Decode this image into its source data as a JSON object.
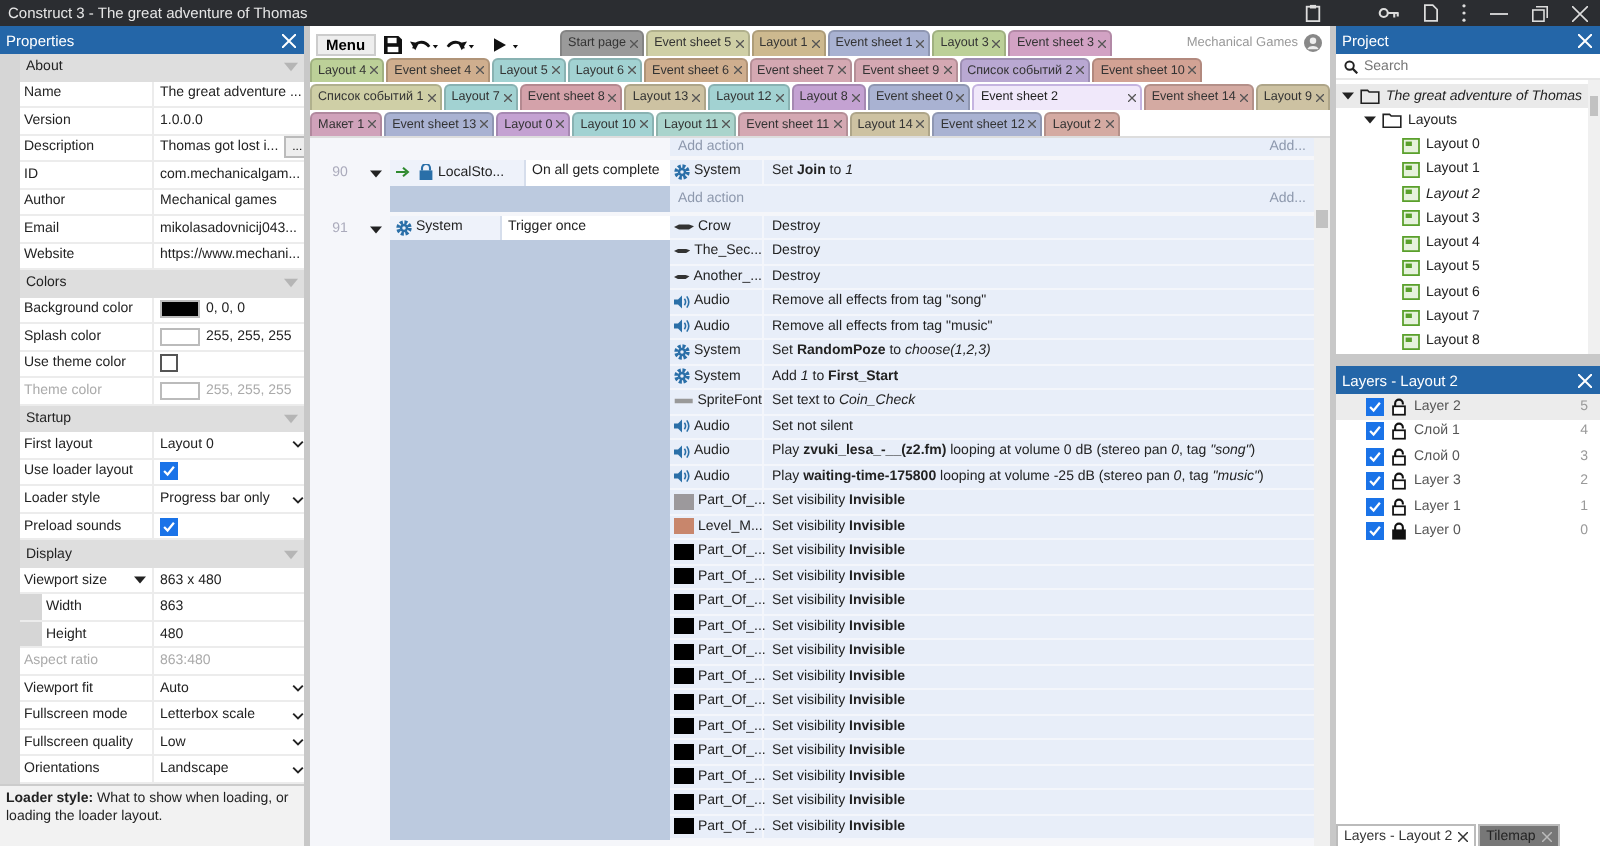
{
  "window": {
    "title": "Construct 3 - The great adventure of Thomas"
  },
  "properties": {
    "title": "Properties",
    "sections": [
      {
        "title": "About",
        "expanded": true,
        "rows": [
          {
            "label": "Name",
            "kind": "text",
            "value": "The great adventure ...",
            "disabled": false
          },
          {
            "label": "Version",
            "kind": "text",
            "value": "1.0.0.0",
            "disabled": false
          },
          {
            "label": "Description",
            "kind": "text-button",
            "value": "Thomas got lost i...",
            "button": "...",
            "disabled": false
          },
          {
            "label": "ID",
            "kind": "text",
            "value": "com.mechanicalgam...",
            "disabled": false
          },
          {
            "label": "Author",
            "kind": "text",
            "value": "Mechanical games",
            "disabled": false
          },
          {
            "label": "Email",
            "kind": "text",
            "value": "mikolasadovnicij043...",
            "disabled": false
          },
          {
            "label": "Website",
            "kind": "text",
            "value": "https://www.mechani...",
            "disabled": false
          }
        ]
      },
      {
        "title": "Colors",
        "expanded": true,
        "rows": [
          {
            "label": "Background color",
            "kind": "color",
            "color": "#000000",
            "value": "0, 0, 0",
            "disabled": false
          },
          {
            "label": "Splash color",
            "kind": "color",
            "color": "#ffffff",
            "value": "255, 255, 255",
            "disabled": false
          },
          {
            "label": "Use theme color",
            "kind": "checkbox",
            "checked": false,
            "disabled": false
          },
          {
            "label": "Theme color",
            "kind": "color",
            "color": "#ffffff",
            "value": "255, 255, 255",
            "disabled": true
          }
        ]
      },
      {
        "title": "Startup",
        "expanded": true,
        "rows": [
          {
            "label": "First layout",
            "kind": "select",
            "value": "Layout 0",
            "disabled": false
          },
          {
            "label": "Use loader layout",
            "kind": "checkbox",
            "checked": true,
            "disabled": false
          },
          {
            "label": "Loader style",
            "kind": "select",
            "value": "Progress bar only",
            "disabled": false
          },
          {
            "label": "Preload sounds",
            "kind": "checkbox",
            "checked": true,
            "disabled": false
          }
        ]
      },
      {
        "title": "Display",
        "expanded": true,
        "rows": [
          {
            "label": "Viewport size",
            "kind": "group",
            "value": "863 x 480",
            "disabled": false,
            "expanded": true,
            "children": [
              {
                "label": "Width",
                "value": "863"
              },
              {
                "label": "Height",
                "value": "480"
              }
            ]
          },
          {
            "label": "Aspect ratio",
            "kind": "text",
            "value": "863:480",
            "disabled": true
          },
          {
            "label": "Viewport fit",
            "kind": "select",
            "value": "Auto",
            "disabled": false
          },
          {
            "label": "Fullscreen mode",
            "kind": "select",
            "value": "Letterbox scale",
            "disabled": false
          },
          {
            "label": "Fullscreen quality",
            "kind": "select",
            "value": "Low",
            "disabled": false
          },
          {
            "label": "Orientations",
            "kind": "select",
            "value": "Landscape",
            "disabled": false
          }
        ]
      }
    ],
    "help": "**Loader style:** What to show when loading, or loading the loader layout."
  },
  "toolbar": {
    "menu": "Menu",
    "user": "Mechanical Games"
  },
  "tab_rows": [
    [
      {
        "label": "Start page",
        "color": "#9a9a9a",
        "selected": false
      },
      {
        "label": "Event sheet 5",
        "color": "#cfcfa6",
        "selected": false
      },
      {
        "label": "Layout 1",
        "color": "#cdb98f",
        "selected": false
      },
      {
        "label": "Event sheet 1",
        "color": "#a9b2d2",
        "selected": false
      },
      {
        "label": "Layout 3",
        "color": "#bcd098",
        "selected": false
      },
      {
        "label": "Event sheet 3",
        "color": "#d2a2c4",
        "selected": false
      }
    ],
    [
      {
        "label": "Layout 4",
        "color": "#bcd098",
        "selected": false
      },
      {
        "label": "Event sheet 4",
        "color": "#cfae8e",
        "selected": false
      },
      {
        "label": "Layout 5",
        "color": "#a2d2d2",
        "selected": false
      },
      {
        "label": "Layout 6",
        "color": "#a2d2d2",
        "selected": false
      },
      {
        "label": "Event sheet 6",
        "color": "#cfae8e",
        "selected": false
      },
      {
        "label": "Event sheet 7",
        "color": "#d4a8b2",
        "selected": false
      },
      {
        "label": "Event sheet 9",
        "color": "#d4a8b2",
        "selected": false
      },
      {
        "label": "Список событий 2",
        "color": "#b9a8d2",
        "selected": false
      },
      {
        "label": "Event sheet 10",
        "color": "#d2a294",
        "selected": false
      }
    ],
    [
      {
        "label": "Список событий 1",
        "color": "#cfcfa6",
        "selected": false
      },
      {
        "label": "Layout 7",
        "color": "#a2d2d2",
        "selected": false
      },
      {
        "label": "Event sheet 8",
        "color": "#d4a2aa",
        "selected": false
      },
      {
        "label": "Layout 13",
        "color": "#cdc2a2",
        "selected": false
      },
      {
        "label": "Layout 12",
        "color": "#a2d2d2",
        "selected": false
      },
      {
        "label": "Layout 8",
        "color": "#c4a2d2",
        "selected": false
      },
      {
        "label": "Event sheet 0",
        "color": "#a9b2d2",
        "selected": false
      },
      {
        "label": "Event sheet 2",
        "color": "#f0e8fa",
        "selected": true
      },
      {
        "label": "Event sheet 14",
        "color": "#d4aaa2",
        "selected": false
      },
      {
        "label": "Layout 9",
        "color": "#cdc2a2",
        "selected": false
      }
    ],
    [
      {
        "label": "Макет 1",
        "color": "#d0a2ba",
        "selected": false
      },
      {
        "label": "Event sheet 13",
        "color": "#a9b2d2",
        "selected": false
      },
      {
        "label": "Layout 0",
        "color": "#c4a2d2",
        "selected": false
      },
      {
        "label": "Layout 10",
        "color": "#a2d2d2",
        "selected": false
      },
      {
        "label": "Layout 11",
        "color": "#aad4cc",
        "selected": false
      },
      {
        "label": "Event sheet 11",
        "color": "#d4a8b2",
        "selected": false
      },
      {
        "label": "Layout 14",
        "color": "#cdc2a2",
        "selected": false
      },
      {
        "label": "Event sheet 12",
        "color": "#a9b2d2",
        "selected": false
      },
      {
        "label": "Layout 2",
        "color": "#d4aaa2",
        "selected": false
      }
    ]
  ],
  "event_sheet": {
    "top_add": {
      "label": "Add action",
      "more": "Add..."
    },
    "events": [
      {
        "number": "90",
        "expanded": true,
        "condition": {
          "object": "LocalSto...",
          "kind": "storage",
          "text": "On all gets complete",
          "trigger": true
        },
        "add": {
          "label": "Add action",
          "more": "Add..."
        },
        "actions": [
          {
            "object": "System",
            "kind": "gear",
            "text": "Set **Join** to *1*"
          }
        ]
      },
      {
        "number": "91",
        "expanded": true,
        "condition": {
          "object": "System",
          "kind": "gear",
          "text": "Trigger once",
          "trigger": false
        },
        "actions": [
          {
            "object": "Crow",
            "kind": "sprite",
            "text": "Destroy"
          },
          {
            "object": "The_Sec...",
            "kind": "sprite",
            "text": "Destroy"
          },
          {
            "object": "Another_...",
            "kind": "sprite",
            "text": "Destroy"
          },
          {
            "object": "Audio",
            "kind": "audio",
            "text": "Remove all effects from tag \"song\""
          },
          {
            "object": "Audio",
            "kind": "audio",
            "text": "Remove all effects from tag \"music\""
          },
          {
            "object": "System",
            "kind": "gear",
            "text": "Set **RandomPoze** to *choose(1,2,3)*"
          },
          {
            "object": "System",
            "kind": "gear",
            "text": "Add *1* to **First_Start**"
          },
          {
            "object": "SpriteFont",
            "kind": "spritefont",
            "text": "Set text to *Coin_Check*"
          },
          {
            "object": "Audio",
            "kind": "audio",
            "text": "Set not silent"
          },
          {
            "object": "Audio",
            "kind": "audio",
            "text": "Play **zvuki_lesa_-__(z2.fm)** looping at volume 0 dB (stereo pan *0*, tag *\"song\"*)"
          },
          {
            "object": "Audio",
            "kind": "audio",
            "text": "Play **waiting-time-175800** looping at volume -25 dB (stereo pan *0*, tag *\"music\"*)"
          },
          {
            "object": "Part_Of_...",
            "kind": "swatch",
            "color": "#9c999c",
            "text": "Set visibility **Invisible**"
          },
          {
            "object": "Level_M...",
            "kind": "swatch",
            "color": "#c8866c",
            "text": "Set visibility **Invisible**"
          },
          {
            "object": "Part_Of_...",
            "kind": "swatch",
            "color": "#000000",
            "text": "Set visibility **Invisible**"
          },
          {
            "object": "Part_Of_...",
            "kind": "swatch",
            "color": "#000000",
            "text": "Set visibility **Invisible**"
          },
          {
            "object": "Part_Of_...",
            "kind": "swatch",
            "color": "#000000",
            "text": "Set visibility **Invisible**"
          },
          {
            "object": "Part_Of_...",
            "kind": "swatch",
            "color": "#000000",
            "text": "Set visibility **Invisible**"
          },
          {
            "object": "Part_Of_...",
            "kind": "swatch",
            "color": "#000000",
            "text": "Set visibility **Invisible**"
          },
          {
            "object": "Part_Of_...",
            "kind": "swatch",
            "color": "#000000",
            "text": "Set visibility **Invisible**"
          },
          {
            "object": "Part_Of_...",
            "kind": "swatch",
            "color": "#000000",
            "text": "Set visibility **Invisible**"
          },
          {
            "object": "Part_Of_...",
            "kind": "swatch",
            "color": "#000000",
            "text": "Set visibility **Invisible**"
          },
          {
            "object": "Part_Of_...",
            "kind": "swatch",
            "color": "#000000",
            "text": "Set visibility **Invisible**"
          },
          {
            "object": "Part_Of_...",
            "kind": "swatch",
            "color": "#000000",
            "text": "Set visibility **Invisible**"
          },
          {
            "object": "Part_Of_...",
            "kind": "swatch",
            "color": "#000000",
            "text": "Set visibility **Invisible**"
          },
          {
            "object": "Part_Of_...",
            "kind": "swatch",
            "color": "#000000",
            "text": "Set visibility **Invisible**"
          }
        ]
      }
    ]
  },
  "project": {
    "title": "Project",
    "search": {
      "placeholder": "Search"
    },
    "tree": {
      "label": "The great adventure of Thomas",
      "expanded": true,
      "selected": true,
      "children": [
        {
          "label": "Layouts",
          "expanded": true,
          "children": [
            {
              "label": "Layout 0",
              "open": false
            },
            {
              "label": "Layout 1",
              "open": false
            },
            {
              "label": "Layout 2",
              "open": true
            },
            {
              "label": "Layout 3",
              "open": false
            },
            {
              "label": "Layout 4",
              "open": false
            },
            {
              "label": "Layout 5",
              "open": false
            },
            {
              "label": "Layout 6",
              "open": false
            },
            {
              "label": "Layout 7",
              "open": false
            },
            {
              "label": "Layout 8",
              "open": false
            }
          ]
        }
      ]
    }
  },
  "layers": {
    "title": "Layers - Layout 2",
    "items": [
      {
        "name": "Layer 2",
        "index": "5",
        "visible": true,
        "locked": false,
        "selected": true
      },
      {
        "name": "Слой 1",
        "index": "4",
        "visible": true,
        "locked": false,
        "selected": false
      },
      {
        "name": "Слой 0",
        "index": "3",
        "visible": true,
        "locked": false,
        "selected": false
      },
      {
        "name": "Layer 3",
        "index": "2",
        "visible": true,
        "locked": false,
        "selected": false
      },
      {
        "name": "Layer 1",
        "index": "1",
        "visible": true,
        "locked": false,
        "selected": false
      },
      {
        "name": "Layer 0",
        "index": "0",
        "visible": true,
        "locked": true,
        "selected": false
      }
    ]
  },
  "bottom_tabs": [
    {
      "label": "Layers - Layout 2",
      "selected": true
    },
    {
      "label": "Tilemap",
      "selected": false
    }
  ]
}
